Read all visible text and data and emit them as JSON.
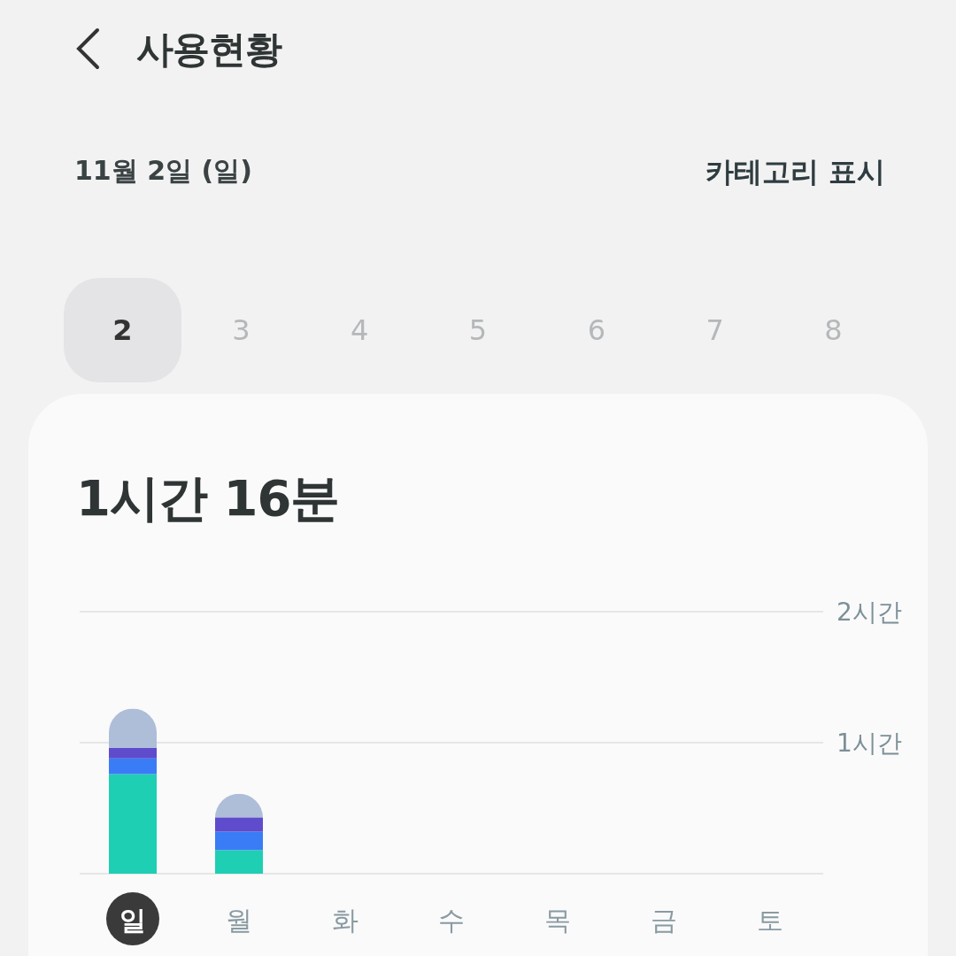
{
  "header": {
    "title": "사용현황"
  },
  "date_label": "11월 2일 (일)",
  "category_toggle": "카테고리 표시",
  "day_tabs": [
    {
      "label": "2",
      "selected": true
    },
    {
      "label": "3",
      "selected": false
    },
    {
      "label": "4",
      "selected": false
    },
    {
      "label": "5",
      "selected": false
    },
    {
      "label": "6",
      "selected": false
    },
    {
      "label": "7",
      "selected": false
    },
    {
      "label": "8",
      "selected": false
    }
  ],
  "summary": {
    "total": "1시간 16분"
  },
  "weekdays": [
    {
      "selected": true
    },
    {
      "selected": false
    },
    {
      "selected": false
    },
    {
      "selected": false
    },
    {
      "selected": false
    },
    {
      "selected": false
    },
    {
      "selected": false
    }
  ],
  "chart_data": {
    "type": "bar",
    "stacked": true,
    "categories": [
      "일",
      "월",
      "화",
      "수",
      "목",
      "금",
      "토"
    ],
    "ylim": [
      0,
      2
    ],
    "yticks": [
      {
        "value": 1,
        "label": "1시간"
      },
      {
        "value": 2,
        "label": "2시간"
      }
    ],
    "series": [
      {
        "color": "#1ecfb4",
        "values": [
          0.76,
          0.18,
          null,
          null,
          null,
          null,
          null
        ]
      },
      {
        "color": "#3a7cf6",
        "values": [
          0.12,
          0.14,
          null,
          null,
          null,
          null,
          null
        ]
      },
      {
        "color": "#5e4ccc",
        "values": [
          0.08,
          0.11,
          null,
          null,
          null,
          null,
          null
        ]
      },
      {
        "color": "#aebdd8",
        "values": [
          0.3,
          0.18,
          null,
          null,
          null,
          null,
          null
        ]
      }
    ]
  }
}
